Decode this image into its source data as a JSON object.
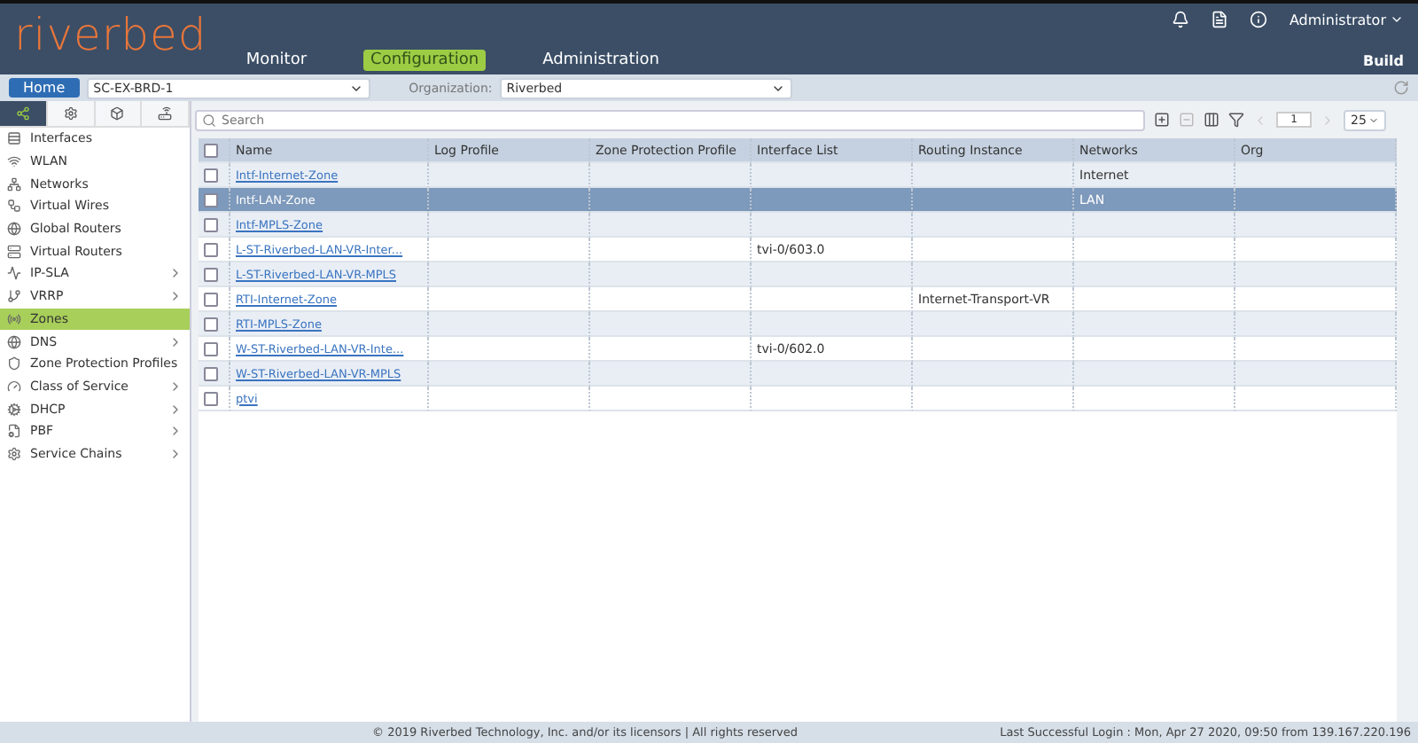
{
  "header": {
    "logo": "riverbed",
    "nav": [
      {
        "label": "Monitor",
        "selected": false
      },
      {
        "label": "Configuration",
        "selected": true
      },
      {
        "label": "Administration",
        "selected": false
      }
    ],
    "user": "Administrator",
    "mode": "Build"
  },
  "subbar": {
    "home": "Home",
    "device": "SC-EX-BRD-1",
    "org_label": "Organization:",
    "org": "Riverbed"
  },
  "sidebar": {
    "tabs": [
      {
        "selected": true
      },
      {
        "selected": false
      },
      {
        "selected": false
      },
      {
        "selected": false
      }
    ],
    "items": [
      {
        "label": "Interfaces",
        "selected": false,
        "expandable": false
      },
      {
        "label": "WLAN",
        "selected": false,
        "expandable": false
      },
      {
        "label": "Networks",
        "selected": false,
        "expandable": false
      },
      {
        "label": "Virtual Wires",
        "selected": false,
        "expandable": false
      },
      {
        "label": "Global Routers",
        "selected": false,
        "expandable": false
      },
      {
        "label": "Virtual Routers",
        "selected": false,
        "expandable": false
      },
      {
        "label": "IP-SLA",
        "selected": false,
        "expandable": true
      },
      {
        "label": "VRRP",
        "selected": false,
        "expandable": true
      },
      {
        "label": "Zones",
        "selected": true,
        "expandable": false
      },
      {
        "label": "DNS",
        "selected": false,
        "expandable": true
      },
      {
        "label": "Zone Protection Profiles",
        "selected": false,
        "expandable": false
      },
      {
        "label": "Class of Service",
        "selected": false,
        "expandable": true
      },
      {
        "label": "DHCP",
        "selected": false,
        "expandable": true
      },
      {
        "label": "PBF",
        "selected": false,
        "expandable": true
      },
      {
        "label": "Service Chains",
        "selected": false,
        "expandable": true
      }
    ]
  },
  "toolbar": {
    "search_placeholder": "Search",
    "page": "1",
    "page_size": "25"
  },
  "table": {
    "header_checked": false,
    "columns": [
      "Name",
      "Log Profile",
      "Zone Protection Profile",
      "Interface List",
      "Routing Instance",
      "Networks",
      "Org"
    ],
    "rows": [
      {
        "selected": false,
        "checked": false,
        "cells": [
          "Intf-Internet-Zone",
          "",
          "",
          "",
          "",
          "Internet",
          ""
        ]
      },
      {
        "selected": true,
        "checked": false,
        "cells": [
          "Intf-LAN-Zone",
          "",
          "",
          "",
          "",
          "LAN",
          ""
        ]
      },
      {
        "selected": false,
        "checked": false,
        "cells": [
          "Intf-MPLS-Zone",
          "",
          "",
          "",
          "",
          "",
          ""
        ]
      },
      {
        "selected": false,
        "checked": false,
        "cells": [
          "L-ST-Riverbed-LAN-VR-Inter...",
          "",
          "",
          "tvi-0/603.0",
          "",
          "",
          ""
        ]
      },
      {
        "selected": false,
        "checked": false,
        "cells": [
          "L-ST-Riverbed-LAN-VR-MPLS",
          "",
          "",
          "",
          "",
          "",
          ""
        ]
      },
      {
        "selected": false,
        "checked": false,
        "cells": [
          "RTI-Internet-Zone",
          "",
          "",
          "",
          "Internet-Transport-VR",
          "",
          ""
        ]
      },
      {
        "selected": false,
        "checked": false,
        "cells": [
          "RTI-MPLS-Zone",
          "",
          "",
          "",
          "",
          "",
          ""
        ]
      },
      {
        "selected": false,
        "checked": false,
        "cells": [
          "W-ST-Riverbed-LAN-VR-Inte...",
          "",
          "",
          "tvi-0/602.0",
          "",
          "",
          ""
        ]
      },
      {
        "selected": false,
        "checked": false,
        "cells": [
          "W-ST-Riverbed-LAN-VR-MPLS",
          "",
          "",
          "",
          "",
          "",
          ""
        ]
      },
      {
        "selected": false,
        "checked": false,
        "cells": [
          "ptvi",
          "",
          "",
          "",
          "",
          "",
          ""
        ]
      }
    ]
  },
  "footer": {
    "copyright": "© 2019 Riverbed Technology, Inc. and/or its licensors | All rights reserved",
    "last_login": "Last Successful Login : Mon, Apr 27 2020, 09:50 from 139.167.220.196"
  }
}
